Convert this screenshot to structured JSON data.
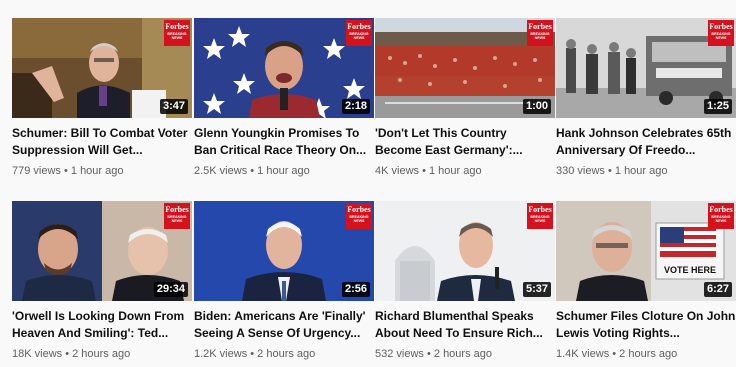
{
  "videos": [
    {
      "title": "Schumer: Bill To Combat Voter Suppression Will Get...",
      "views": "779 views",
      "age": "1 hour ago",
      "duration": "3:47",
      "badge_brand": "Forbes",
      "badge_sub": "BREAKING NEWS"
    },
    {
      "title": "Glenn Youngkin Promises To Ban Critical Race Theory On...",
      "views": "2.5K views",
      "age": "1 hour ago",
      "duration": "2:18",
      "badge_brand": "Forbes",
      "badge_sub": "BREAKING NEWS"
    },
    {
      "title": "'Don't Let This Country Become East Germany':...",
      "views": "4K views",
      "age": "1 hour ago",
      "duration": "1:00",
      "badge_brand": "Forbes",
      "badge_sub": "BREAKING NEWS"
    },
    {
      "title": "Hank Johnson Celebrates 65th Anniversary Of Freedo...",
      "views": "330 views",
      "age": "1 hour ago",
      "duration": "1:25",
      "badge_brand": "Forbes",
      "badge_sub": "BREAKING NEWS"
    },
    {
      "title": "'Orwell Is Looking Down From Heaven And Smiling': Ted...",
      "views": "18K views",
      "age": "2 hours ago",
      "duration": "29:34",
      "badge_brand": "Forbes",
      "badge_sub": "BREAKING NEWS"
    },
    {
      "title": "Biden: Americans Are 'Finally' Seeing A Sense Of Urgency...",
      "views": "1.2K views",
      "age": "2 hours ago",
      "duration": "2:56",
      "badge_brand": "Forbes",
      "badge_sub": "BREAKING NEWS"
    },
    {
      "title": "Richard Blumenthal Speaks About Need To Ensure Rich...",
      "views": "532 views",
      "age": "2 hours ago",
      "duration": "5:37",
      "badge_brand": "Forbes",
      "badge_sub": "BREAKING NEWS"
    },
    {
      "title": "Schumer Files Cloture On John Lewis Voting Rights...",
      "views": "1.4K views",
      "age": "2 hours ago",
      "duration": "6:27",
      "badge_brand": "Forbes",
      "badge_sub": "BREAKING NEWS",
      "sign_text": "VOTE HERE"
    }
  ]
}
